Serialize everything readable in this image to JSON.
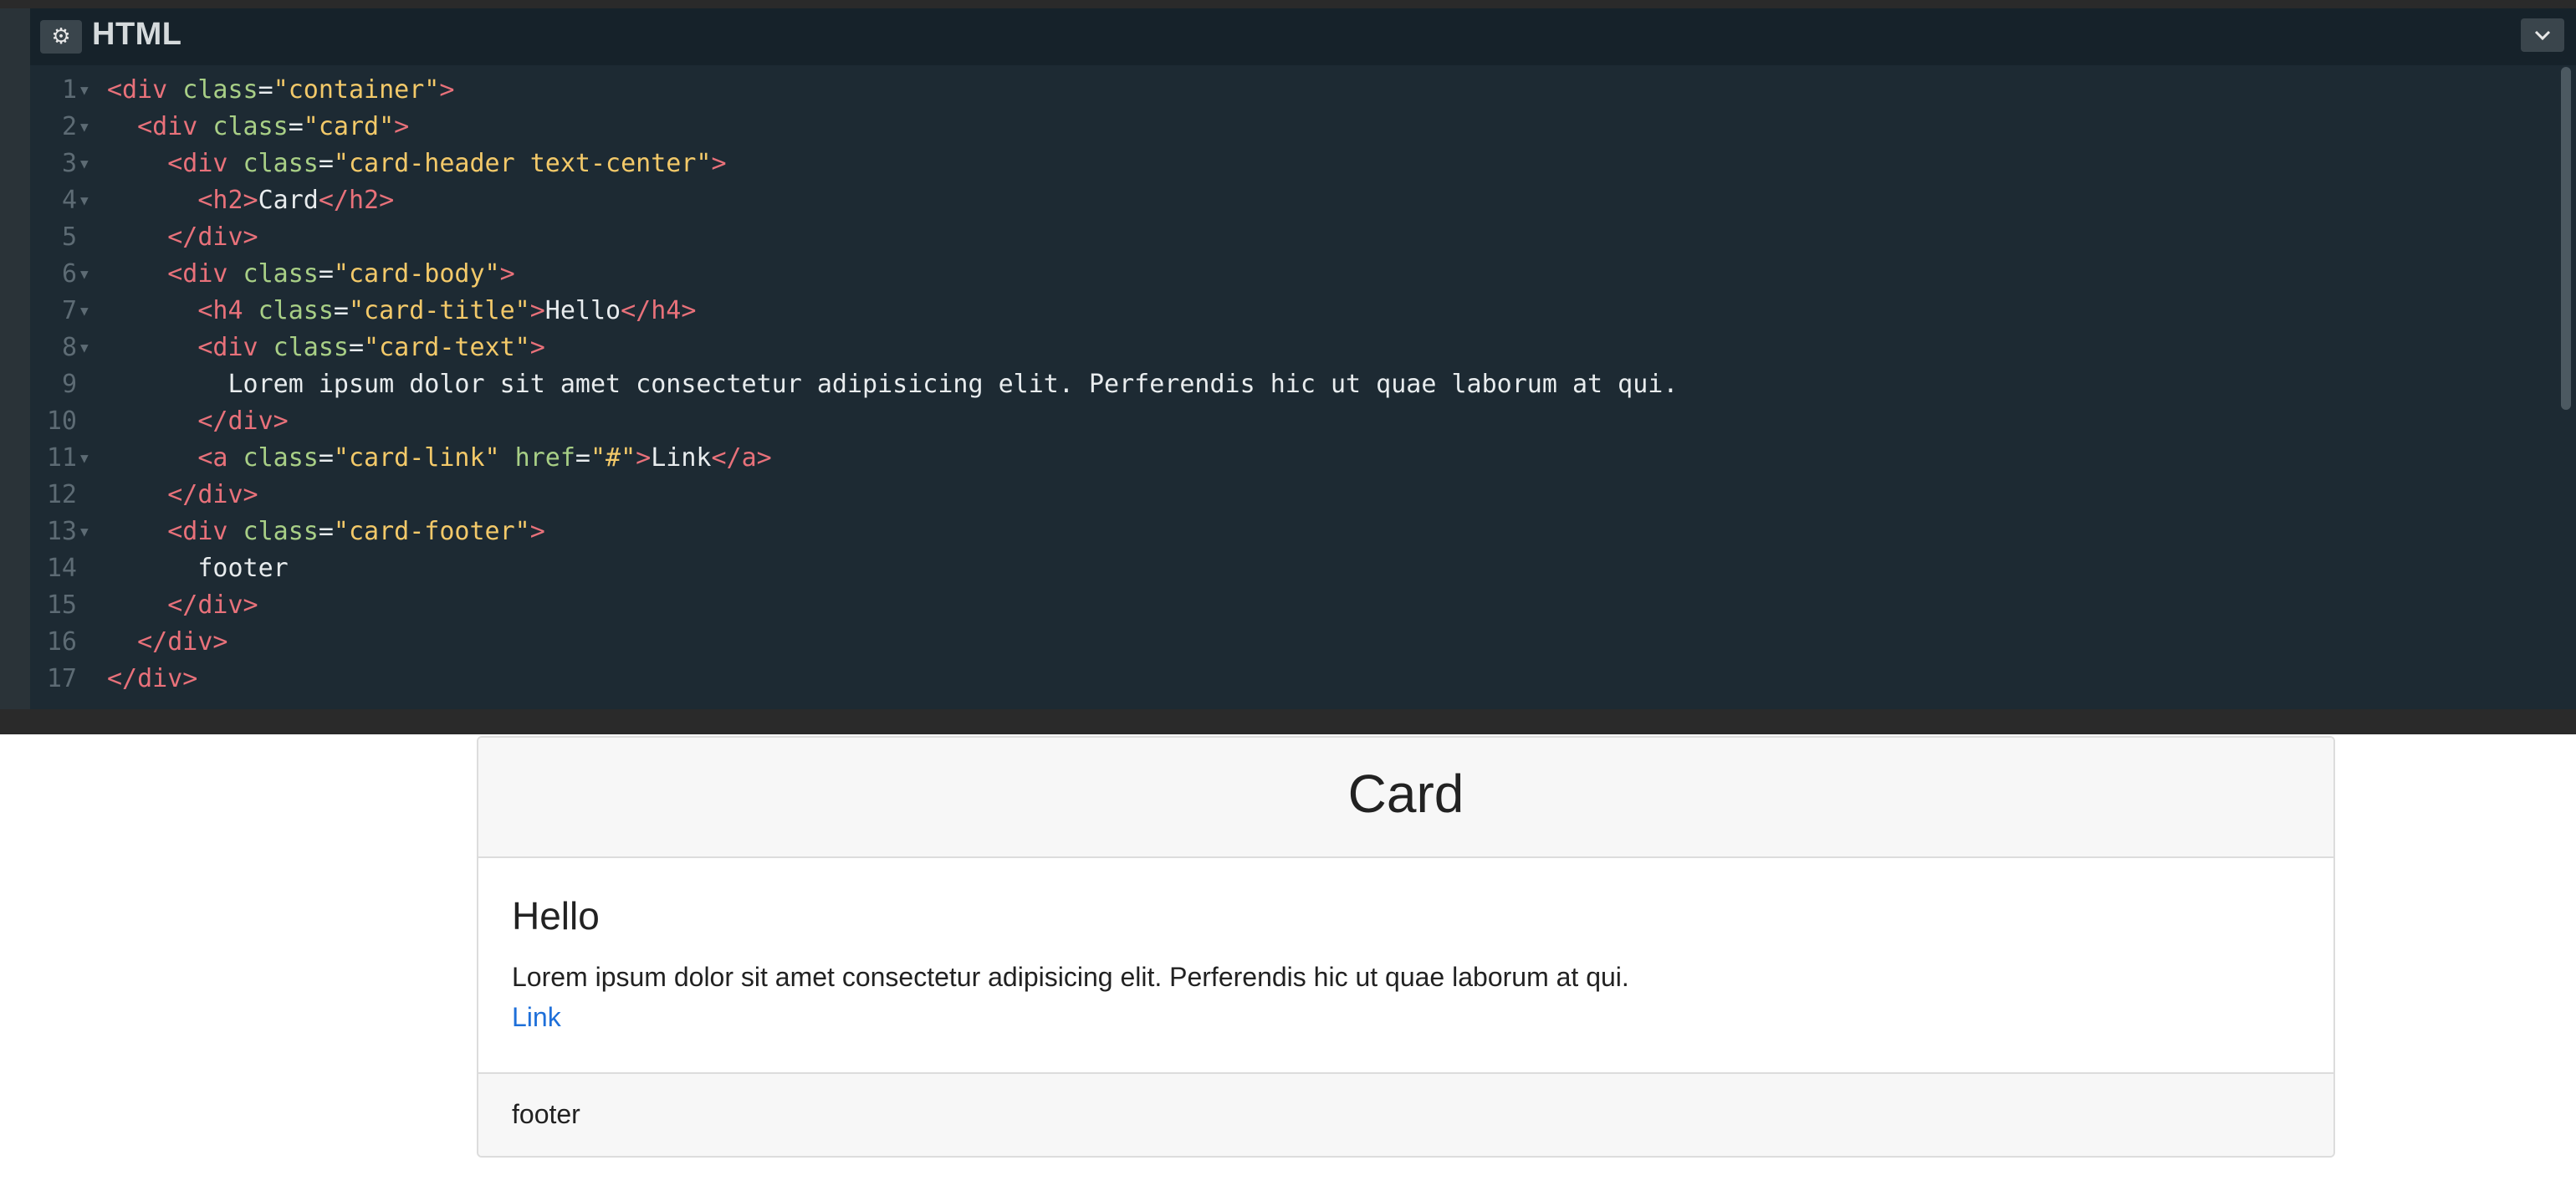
{
  "editor": {
    "title": "HTML",
    "gear_icon": "gear-icon",
    "collapse_icon": "chevron-down-icon",
    "lines": [
      {
        "n": "1",
        "fold": true,
        "indent": 0,
        "tokens": [
          [
            "tg",
            "<div"
          ],
          [
            "at",
            " class"
          ],
          [
            "tx",
            "="
          ],
          [
            "st",
            "\"container\""
          ],
          [
            "tg",
            ">"
          ]
        ]
      },
      {
        "n": "2",
        "fold": true,
        "indent": 1,
        "tokens": [
          [
            "tg",
            "<div"
          ],
          [
            "at",
            " class"
          ],
          [
            "tx",
            "="
          ],
          [
            "st",
            "\"card\""
          ],
          [
            "tg",
            ">"
          ]
        ]
      },
      {
        "n": "3",
        "fold": true,
        "indent": 2,
        "tokens": [
          [
            "tg",
            "<div"
          ],
          [
            "at",
            " class"
          ],
          [
            "tx",
            "="
          ],
          [
            "st",
            "\"card-header text-center\""
          ],
          [
            "tg",
            ">"
          ]
        ]
      },
      {
        "n": "4",
        "fold": true,
        "indent": 3,
        "tokens": [
          [
            "tg",
            "<h2>"
          ],
          [
            "tx",
            "Card"
          ],
          [
            "tg",
            "</h2>"
          ]
        ]
      },
      {
        "n": "5",
        "fold": false,
        "indent": 2,
        "tokens": [
          [
            "tg",
            "</div>"
          ]
        ]
      },
      {
        "n": "6",
        "fold": true,
        "indent": 2,
        "tokens": [
          [
            "tg",
            "<div"
          ],
          [
            "at",
            " class"
          ],
          [
            "tx",
            "="
          ],
          [
            "st",
            "\"card-body\""
          ],
          [
            "tg",
            ">"
          ]
        ]
      },
      {
        "n": "7",
        "fold": true,
        "indent": 3,
        "tokens": [
          [
            "tg",
            "<h4"
          ],
          [
            "at",
            " class"
          ],
          [
            "tx",
            "="
          ],
          [
            "st",
            "\"card-title\""
          ],
          [
            "tg",
            ">"
          ],
          [
            "tx",
            "Hello"
          ],
          [
            "tg",
            "</h4>"
          ]
        ]
      },
      {
        "n": "8",
        "fold": true,
        "indent": 3,
        "tokens": [
          [
            "tg",
            "<div"
          ],
          [
            "at",
            " class"
          ],
          [
            "tx",
            "="
          ],
          [
            "st",
            "\"card-text\""
          ],
          [
            "tg",
            ">"
          ]
        ]
      },
      {
        "n": "9",
        "fold": false,
        "indent": 4,
        "tokens": [
          [
            "tx",
            "Lorem ipsum dolor sit amet consectetur adipisicing elit. Perferendis hic ut quae laborum at qui."
          ]
        ]
      },
      {
        "n": "10",
        "fold": false,
        "indent": 3,
        "tokens": [
          [
            "tg",
            "</div>"
          ]
        ]
      },
      {
        "n": "11",
        "fold": true,
        "indent": 3,
        "tokens": [
          [
            "tg",
            "<a"
          ],
          [
            "at",
            " class"
          ],
          [
            "tx",
            "="
          ],
          [
            "st",
            "\"card-link\""
          ],
          [
            "at",
            " href"
          ],
          [
            "tx",
            "="
          ],
          [
            "st",
            "\"#\""
          ],
          [
            "tg",
            ">"
          ],
          [
            "tx",
            "Link"
          ],
          [
            "tg",
            "</a>"
          ]
        ]
      },
      {
        "n": "12",
        "fold": false,
        "indent": 2,
        "tokens": [
          [
            "tg",
            "</div>"
          ]
        ]
      },
      {
        "n": "13",
        "fold": true,
        "indent": 2,
        "tokens": [
          [
            "tg",
            "<div"
          ],
          [
            "at",
            " class"
          ],
          [
            "tx",
            "="
          ],
          [
            "st",
            "\"card-footer\""
          ],
          [
            "tg",
            ">"
          ]
        ]
      },
      {
        "n": "14",
        "fold": false,
        "indent": 3,
        "tokens": [
          [
            "tx",
            "footer"
          ]
        ]
      },
      {
        "n": "15",
        "fold": false,
        "indent": 2,
        "tokens": [
          [
            "tg",
            "</div>"
          ]
        ]
      },
      {
        "n": "16",
        "fold": false,
        "indent": 1,
        "tokens": [
          [
            "tg",
            "</div>"
          ]
        ]
      },
      {
        "n": "17",
        "fold": false,
        "indent": 0,
        "tokens": [
          [
            "tg",
            "</div>"
          ]
        ]
      }
    ]
  },
  "preview": {
    "header": "Card",
    "title": "Hello",
    "text": "Lorem ipsum dolor sit amet consectetur adipisicing elit. Perferendis hic ut quae laborum at qui.",
    "link": "Link",
    "footer": "footer"
  },
  "colors": {
    "editor_bg": "#1d2a33",
    "tag": "#e8717a",
    "attribute": "#a8cf86",
    "string": "#f3c969",
    "text": "#e8ecee",
    "link": "#1e6fd9"
  }
}
